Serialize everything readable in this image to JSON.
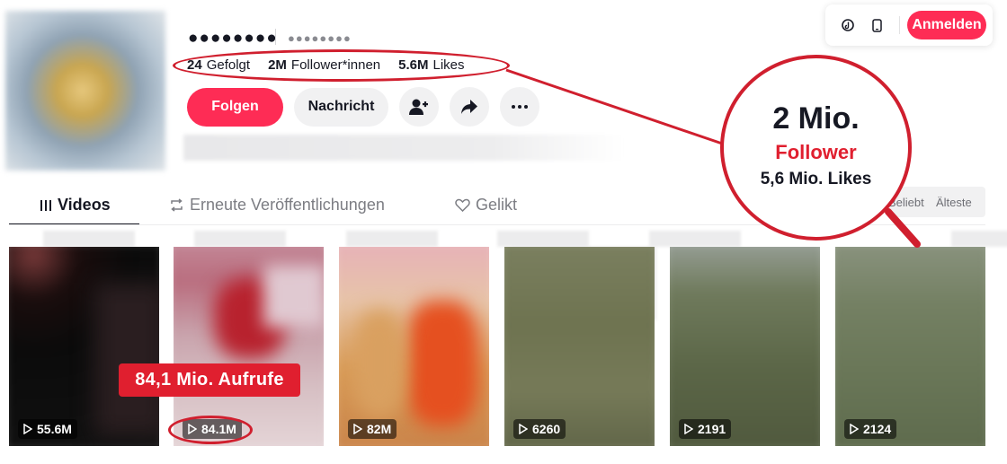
{
  "profile": {
    "username": "●●●●●●●●",
    "nickname": "●●●●●●●●",
    "stats": [
      {
        "value": "24",
        "label": "Gefolgt"
      },
      {
        "value": "2M",
        "label": "Follower*innen"
      },
      {
        "value": "5.6M",
        "label": "Likes"
      }
    ],
    "follow_label": "Folgen",
    "message_label": "Nachricht"
  },
  "header": {
    "login_label": "Anmelden"
  },
  "tabs": {
    "videos": "Videos",
    "reposts": "Erneute Veröffentlichungen",
    "liked": "Gelikt"
  },
  "sort": {
    "popular": "Beliebt",
    "oldest": "Älteste"
  },
  "videos": [
    {
      "views": "55.6M"
    },
    {
      "views": "84.1M"
    },
    {
      "views": "82M"
    },
    {
      "views": "6260"
    },
    {
      "views": "2191"
    },
    {
      "views": "2124"
    }
  ],
  "annotations": {
    "views_callout": "84,1 Mio. Aufrufe",
    "zoom_followers": "2 Mio.",
    "zoom_label": "Follower",
    "zoom_likes": "5,6 Mio. Likes",
    "color": "#d01f2e"
  },
  "colors": {
    "accent": "#fe2c55",
    "text": "#161823"
  }
}
